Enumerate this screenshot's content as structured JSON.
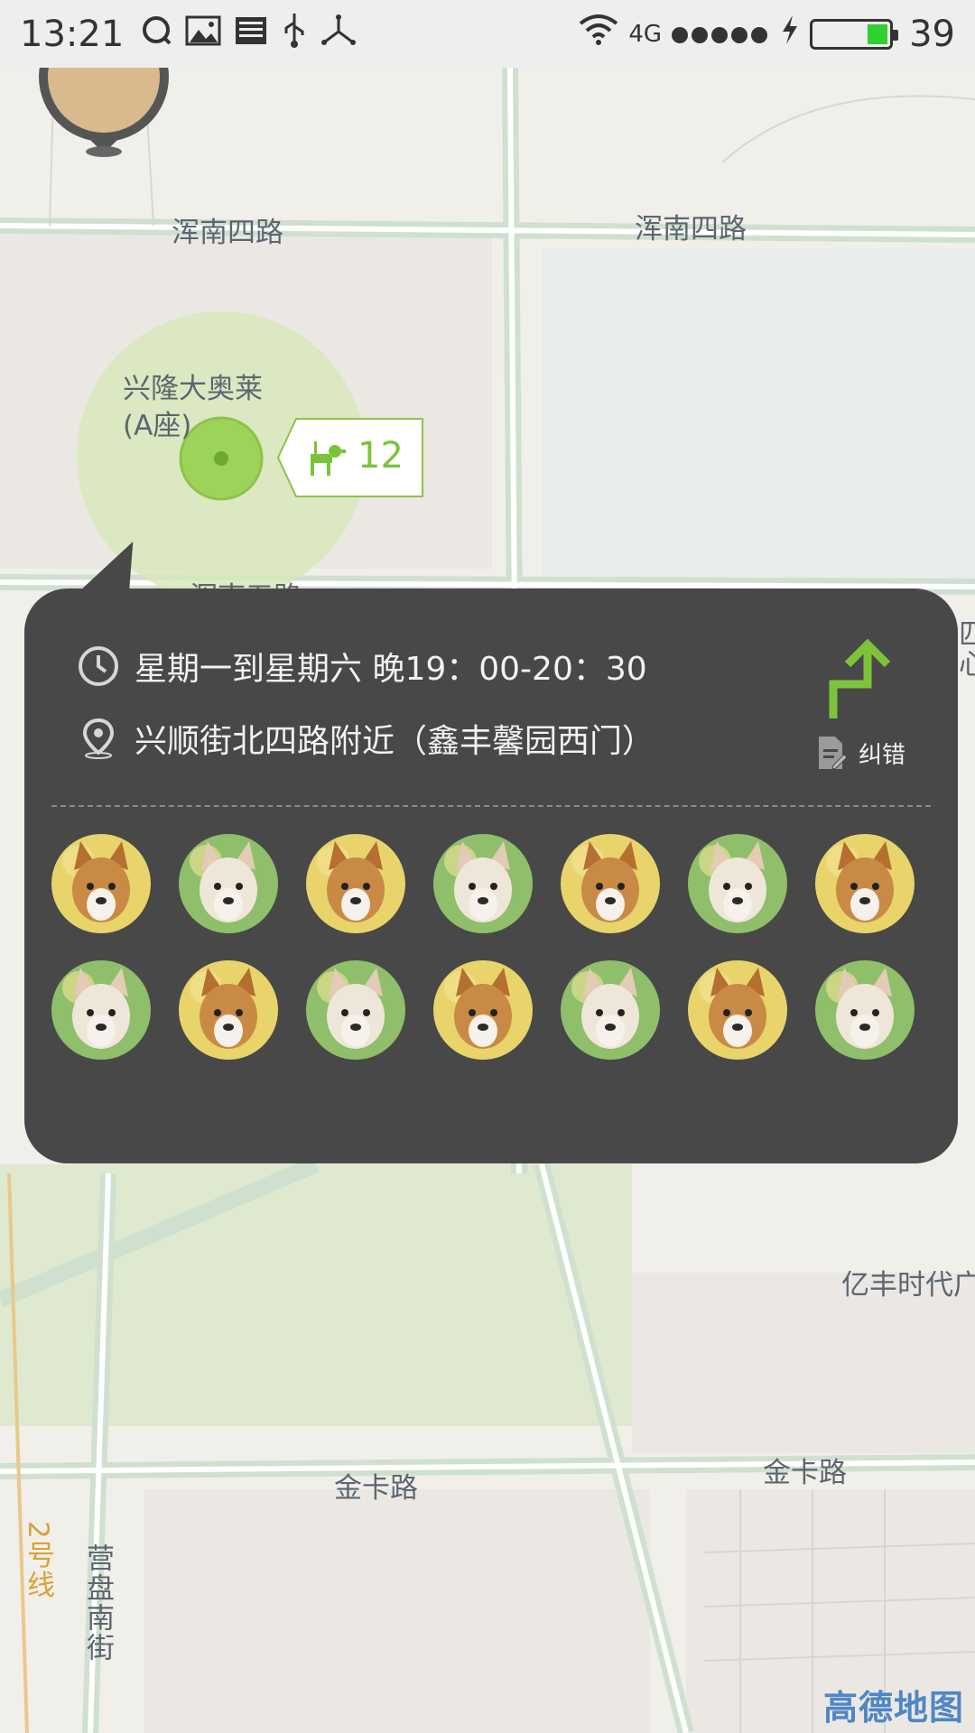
{
  "status_bar": {
    "time": "13:21",
    "network": "4G",
    "battery_level": "39",
    "icons": [
      "qq-icon",
      "image-icon",
      "news-icon",
      "usb-icon",
      "share-icon",
      "wifi-icon",
      "signal-icon",
      "charging-icon",
      "battery-icon"
    ]
  },
  "map": {
    "labels": {
      "road_1": "浑南四路",
      "road_2": "浑南四路",
      "road_3": "浑南五路",
      "poi_name_line1": "兴隆大奥莱",
      "poi_name_line2": "(A座)",
      "poi_right": "亿丰时代广",
      "road_4": "金卡路",
      "road_5": "金卡路",
      "metro_line": "2号线",
      "street_vertical": "营盘南街",
      "edge_text": "匹心"
    },
    "dog_count": "12",
    "watermark": "高德地图",
    "colors": {
      "accent_green": "#7cc33b",
      "popup_bg": "#484848"
    }
  },
  "popup": {
    "schedule": "星期一到星期六 晚19：00-20：30",
    "location": "兴顺街北四路附近（鑫丰馨园西门）",
    "correct_label": "纠错",
    "dog_avatars": [
      "corgi",
      "chihuahua",
      "corgi",
      "chihuahua",
      "corgi",
      "chihuahua",
      "corgi",
      "chihuahua",
      "corgi",
      "chihuahua",
      "corgi",
      "chihuahua",
      "corgi",
      "chihuahua"
    ]
  }
}
